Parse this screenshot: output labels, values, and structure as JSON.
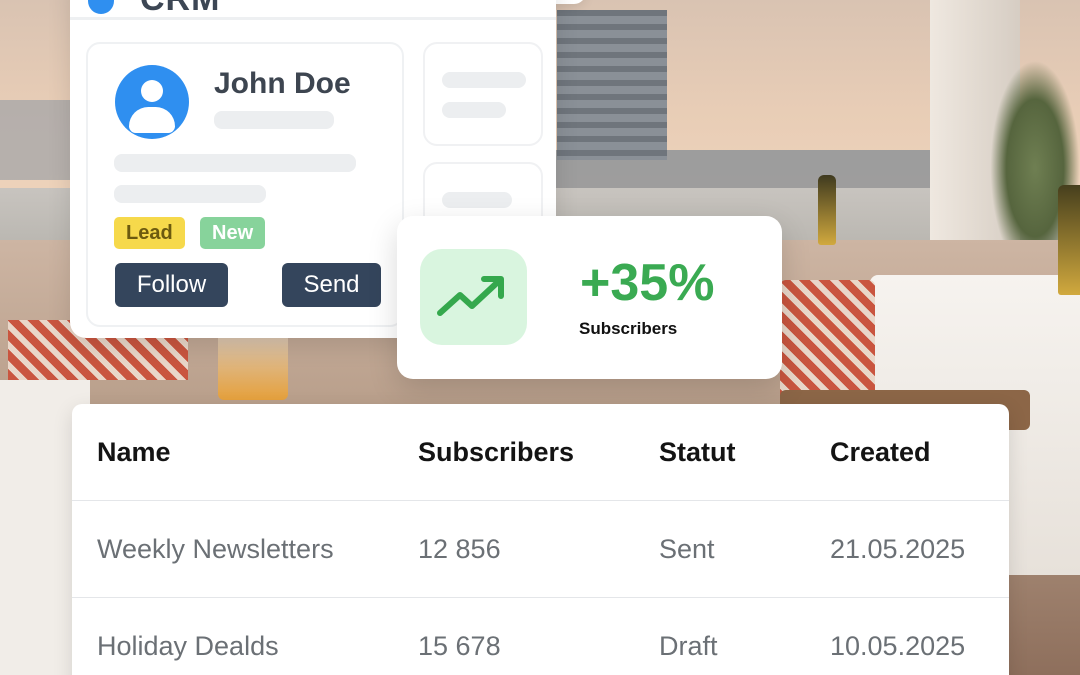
{
  "crm": {
    "logo_text": "CRM",
    "profile": {
      "name": "John Doe",
      "tags": [
        "Lead",
        "New"
      ],
      "buttons": {
        "follow": "Follow",
        "send": "Send"
      }
    }
  },
  "stats": {
    "value": "+35%",
    "label": "Subscribers",
    "icon": "trending-up-icon",
    "accent_color": "#3aaa52"
  },
  "table": {
    "columns": [
      "Name",
      "Subscribers",
      "Statut",
      "Created"
    ],
    "rows": [
      [
        "Weekly Newsletters",
        "12 856",
        "Sent",
        "21.05.2025"
      ],
      [
        "Holiday Dealds",
        "15 678",
        "Draft",
        "10.05.2025"
      ]
    ]
  },
  "colors": {
    "brand_blue": "#2f8ff0",
    "button_dark": "#34455c",
    "tag_lead": "#f6d94b",
    "tag_new": "#87d39b"
  }
}
